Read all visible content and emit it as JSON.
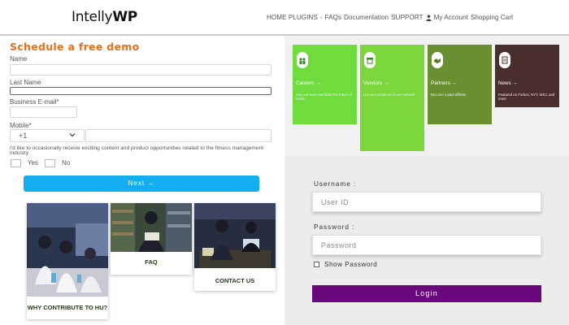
{
  "brand": {
    "logo_regular": "Intelly",
    "logo_bold": "WP"
  },
  "nav": {
    "home_plugins": "HOME PLUGINS",
    "sep": "-",
    "faqs": "FAQs",
    "documentation": "Documentation",
    "support": "SUPPORT",
    "my_account": "My Account",
    "shopping_cart": "Shopping Cart"
  },
  "demo_form": {
    "title": "Schedule a free demo",
    "name_label": "Name",
    "last_name_label": "Last Name",
    "business_email_label": "Business E-mail*",
    "mobile_label": "Mobile*",
    "country_code": "+1",
    "consent_text": "I'd like to occasionally receive exciting content and product opportunities related to the fitness management industry",
    "yes_label": "Yes",
    "no_label": "No",
    "next_label": "Next →"
  },
  "cards": [
    {
      "caption": "WHY CONTRIBUTE TO HU?"
    },
    {
      "caption": "FAQ"
    },
    {
      "caption": "CONTACT US"
    }
  ],
  "tiles": [
    {
      "title": "Careers →",
      "desc": "Join our team and build the future of Intelly",
      "color": "#6fdb3c"
    },
    {
      "title": "Vendors →",
      "desc": "List your products on our network",
      "color": "#7ad63a"
    },
    {
      "title": "Partners →",
      "desc": "Become a paid affiliate",
      "color": "#6a8f30"
    },
    {
      "title": "News →",
      "desc": "Featured on Forbes, NYT, WSJ, and more",
      "color": "#4a2d2d"
    }
  ],
  "login": {
    "username_label": "Username :",
    "username_placeholder": "User ID",
    "password_label": "Password :",
    "password_placeholder": "Password",
    "show_password_label": "Show Password",
    "login_label": "Login"
  },
  "colors": {
    "accent_orange": "#e8701a",
    "next_blue": "#13aef0",
    "login_purple": "#6a077d"
  }
}
